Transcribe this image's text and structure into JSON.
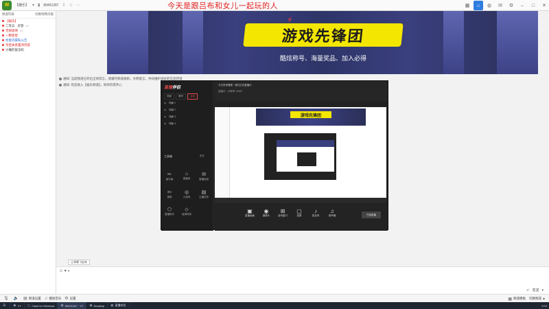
{
  "topbar": {
    "logo_text": "W",
    "room_label": "【娱乐】",
    "room_id": "89491287",
    "marquee": "今天是跟吕布和女儿一起玩的人",
    "icons": [
      "home-icon",
      "grid-icon",
      "gamepad-icon",
      "chat-icon",
      "bell-icon",
      "settings-icon",
      "minimize-icon",
      "maximize-icon",
      "close-icon"
    ]
  },
  "leftpanel": {
    "header_left": "频道列表",
    "header_right": "切换到网页版",
    "rows": [
      {
        "label": "【娱乐】",
        "color": "red",
        "tag": ""
      },
      {
        "label": "二等兵 · 房管",
        "color": "",
        "tag": "LV"
      },
      {
        "label": "无限旋律",
        "color": "red",
        "tag": "LV"
      },
      {
        "label": "一颗星星",
        "color": "red",
        "tag": ""
      },
      {
        "label": "抢麦内属私公告",
        "color": "blue",
        "tag": ""
      },
      {
        "label": "亲密关系置顶内容",
        "color": "red",
        "tag": ""
      },
      {
        "label": "沙雕的复读机",
        "color": "",
        "tag": ""
      }
    ]
  },
  "banner": {
    "title": "游戏先锋团",
    "subtitle": "酷炫称号、海量奖品、加入必得"
  },
  "sysmsgs": [
    {
      "text": "通知: 当前频道已开启全体禁言，请遵守频道规则，文明发言，共同维护良好的交流环境"
    },
    {
      "text": "通知: 欢迎进入【娱乐频道】，祝你玩得开心"
    }
  ],
  "win1": {
    "logo_a": "直播",
    "logo_b": "伴侣",
    "tabs": [
      "场景",
      "素材",
      "互动"
    ],
    "scenes": [
      "场景 1",
      "场景 2",
      "场景 3",
      "场景 4"
    ],
    "toolbox_label": "工具箱",
    "toolbox_more": "更多",
    "tools": [
      {
        "icon": "✂",
        "label": "画中画"
      },
      {
        "icon": "⌂",
        "label": "直播间"
      },
      {
        "icon": "✉",
        "label": "直播贴纸"
      },
      {
        "icon": "✄",
        "label": "美颜"
      },
      {
        "icon": "◎",
        "label": "小游戏"
      },
      {
        "icon": "▤",
        "label": "主播任务"
      },
      {
        "icon": "⬡",
        "label": "直播助手"
      },
      {
        "icon": "◇",
        "label": "高清特效"
      }
    ],
    "header_line1": "今日来来看看 · 我们正在直播中",
    "header_line2": "直播中 · 分辨率 1080P",
    "bottom_buttons": [
      {
        "icon": "▣",
        "label": "直播画面"
      },
      {
        "icon": "◉",
        "label": "摄像头"
      },
      {
        "icon": "⊞",
        "label": "游戏窗口"
      },
      {
        "icon": "▢",
        "label": "投屏"
      },
      {
        "icon": "♪",
        "label": "麦克风"
      },
      {
        "icon": "♫",
        "label": "扬声器"
      }
    ],
    "golive_label": "开始直播"
  },
  "preview": {
    "mini_title": "游戏先锋团"
  },
  "input": {
    "chip_text": "让弹幕飞起来",
    "send_label": "发送"
  },
  "bottombar": {
    "items": [
      {
        "icon": "🎤",
        "label": ""
      },
      {
        "icon": "🔊",
        "label": ""
      },
      {
        "icon": "▤",
        "label": "频道设置"
      },
      {
        "icon": "♫",
        "label": "播放音乐"
      },
      {
        "icon": "⚙",
        "label": "设置"
      }
    ],
    "right_items": [
      "频道模板",
      "切换频道"
    ]
  },
  "taskbar": {
    "items": [
      {
        "icon": "⊞",
        "label": ""
      },
      {
        "icon": "◉",
        "label": "YY"
      },
      {
        "icon": "◻",
        "label": "Clash for Windows"
      },
      {
        "icon": "◉",
        "label": "89491287 · YY"
      },
      {
        "icon": "◉",
        "label": "Bandizip"
      },
      {
        "icon": "◉",
        "label": "直播伴侣"
      }
    ],
    "time": "9:00"
  },
  "colors": {
    "accent": "#2f7de1",
    "marquee": "#e21e1e",
    "banner_title_bg": "#f3e600"
  }
}
